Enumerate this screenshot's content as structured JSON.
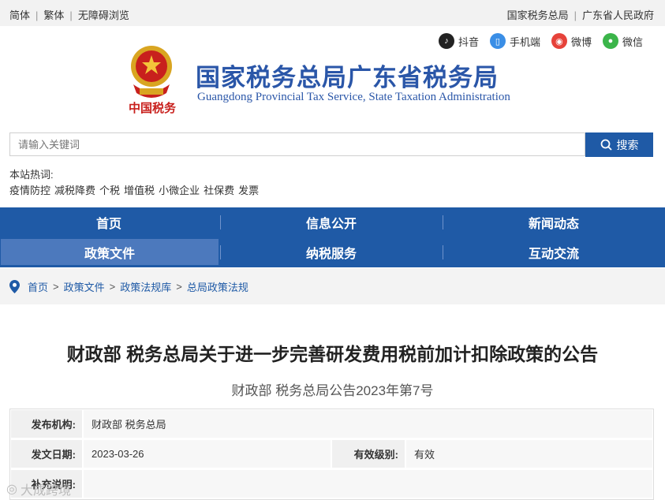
{
  "topbar": {
    "left": [
      "简体",
      "繁体",
      "无障碍浏览"
    ],
    "right": [
      "国家税务总局",
      "广东省人民政府"
    ]
  },
  "social": {
    "douyin": "抖音",
    "mobile": "手机端",
    "weibo": "微博",
    "wechat": "微信"
  },
  "header": {
    "emblem_text": "中国税务",
    "title": "国家税务总局广东省税务局",
    "subtitle": "Guangdong Provincial Tax Service, State Taxation Administration"
  },
  "search": {
    "placeholder": "请输入关键词",
    "button": "搜索"
  },
  "hot": {
    "label": "本站热词:",
    "words": [
      "疫情防控",
      "减税降费",
      "个税",
      "增值税",
      "小微企业",
      "社保费",
      "发票"
    ]
  },
  "nav": {
    "items": [
      "首页",
      "信息公开",
      "新闻动态",
      "政策文件",
      "纳税服务",
      "互动交流"
    ],
    "active": "政策文件"
  },
  "breadcrumb": [
    "首页",
    "政策文件",
    "政策法规库",
    "总局政策法规"
  ],
  "article": {
    "title": "财政部 税务总局关于进一步完善研发费用税前加计扣除政策的公告",
    "subtitle": "财政部 税务总局公告2023年第7号"
  },
  "meta": {
    "publisher_label": "发布机构:",
    "publisher": "财政部 税务总局",
    "date_label": "发文日期:",
    "date": "2023-03-26",
    "validity_label": "有效级别:",
    "validity": "有效",
    "note_label": "补充说明:"
  },
  "watermark": "大成跨境",
  "colors": {
    "brand": "#1f5aa6",
    "nav_active": "#4c79bd"
  }
}
